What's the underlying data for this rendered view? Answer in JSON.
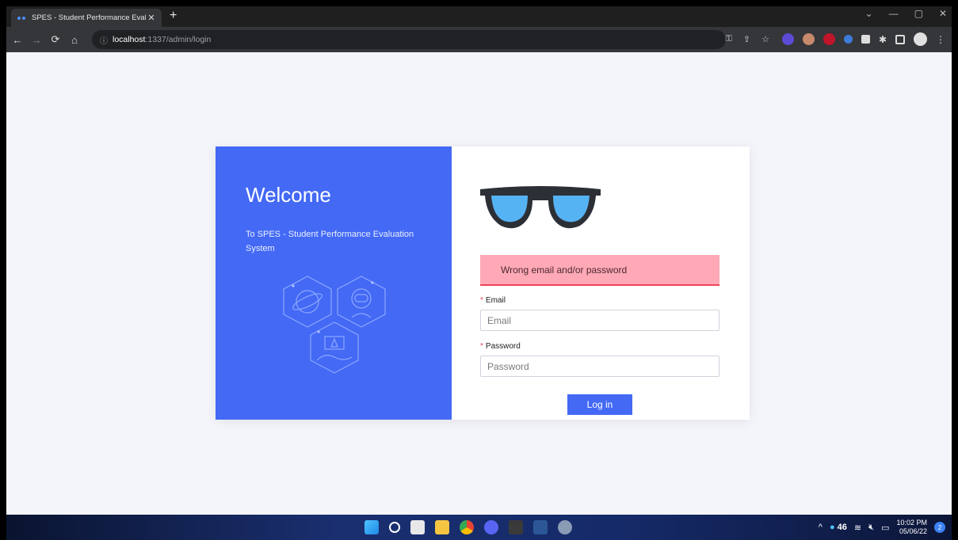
{
  "browser": {
    "tab_title": "SPES - Student Performance Evalu",
    "tab_close": "✕",
    "new_tab": "+",
    "url_host": "localhost",
    "url_path": ":1337/admin/login",
    "window_controls": [
      "⌄",
      "—",
      "▢",
      "✕"
    ]
  },
  "left_panel": {
    "welcome": "Welcome",
    "subtitle": "To SPES - Student Performance Evaluation System",
    "background_color": "#4369f5"
  },
  "login_form": {
    "error_message": "Wrong email and/or password",
    "email_label": "Email",
    "email_placeholder": "Email",
    "password_label": "Password",
    "password_placeholder": "Password",
    "required_marker": "*",
    "submit_label": "Log in"
  },
  "taskbar": {
    "weather_temp": "46",
    "time": "10:02 PM",
    "date": "05/06/22",
    "notification_count": "2"
  }
}
